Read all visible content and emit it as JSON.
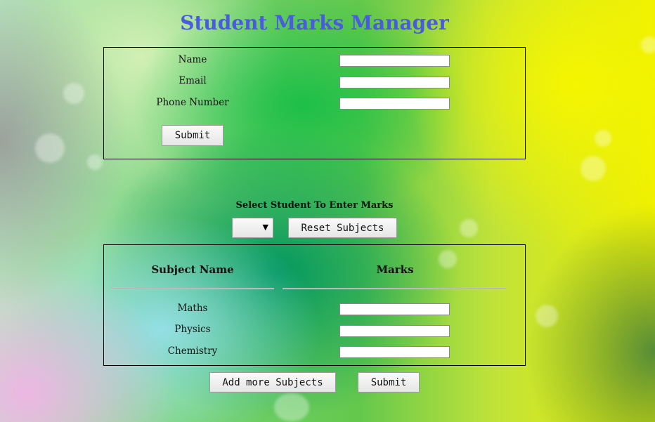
{
  "title": "Student Marks Manager",
  "student_form": {
    "fields": [
      {
        "label": "Name",
        "value": ""
      },
      {
        "label": "Email",
        "value": ""
      },
      {
        "label": "Phone Number",
        "value": ""
      }
    ],
    "submit_label": "Submit"
  },
  "marks": {
    "select_title": "Select Student To Enter Marks",
    "selected_student": "",
    "reset_label": "Reset Subjects",
    "headers": {
      "subject": "Subject Name",
      "marks": "Marks"
    },
    "subjects": [
      {
        "name": "Maths",
        "value": ""
      },
      {
        "name": "Physics",
        "value": ""
      },
      {
        "name": "Chemistry",
        "value": ""
      }
    ],
    "add_more_label": "Add more Subjects",
    "submit_label": "Submit"
  },
  "icons": {
    "select_arrow": "▼"
  }
}
